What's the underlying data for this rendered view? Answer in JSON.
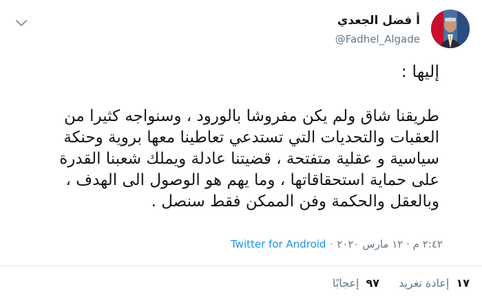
{
  "user": {
    "name": "أ فضل الجعدي",
    "handle": "@Fadhel_Algade"
  },
  "tweet": {
    "heading": "إليها :",
    "lines": [
      "طريقنا شاق ولم يكن مفروشا بالورود ، وسنواجه كثيرا من",
      "العقبات والتحديات التي تستدعي تعاطينا معها بروية وحنكة",
      "سياسية و عقلية متفتحة ، قضيتنا عادلة ويملك شعبنا القدرة",
      "على حماية استحقاقاتها ، وما يهم هو الوصول الى الهدف ،",
      "وبالعقل والحكمة وفن الممكن فقط سنصل ."
    ],
    "timestamp": "٢:٤٢ م · ١٢ مارس ٢٠٢٠",
    "source": "Twitter for Android"
  },
  "stats": {
    "retweets_count": "١٧",
    "retweets_label": "إعادة تغريد",
    "likes_count": "٩٧",
    "likes_label": "إعجابًا"
  },
  "colors": {
    "link": "#1b95e0",
    "muted": "#657786",
    "text": "#14171a"
  }
}
